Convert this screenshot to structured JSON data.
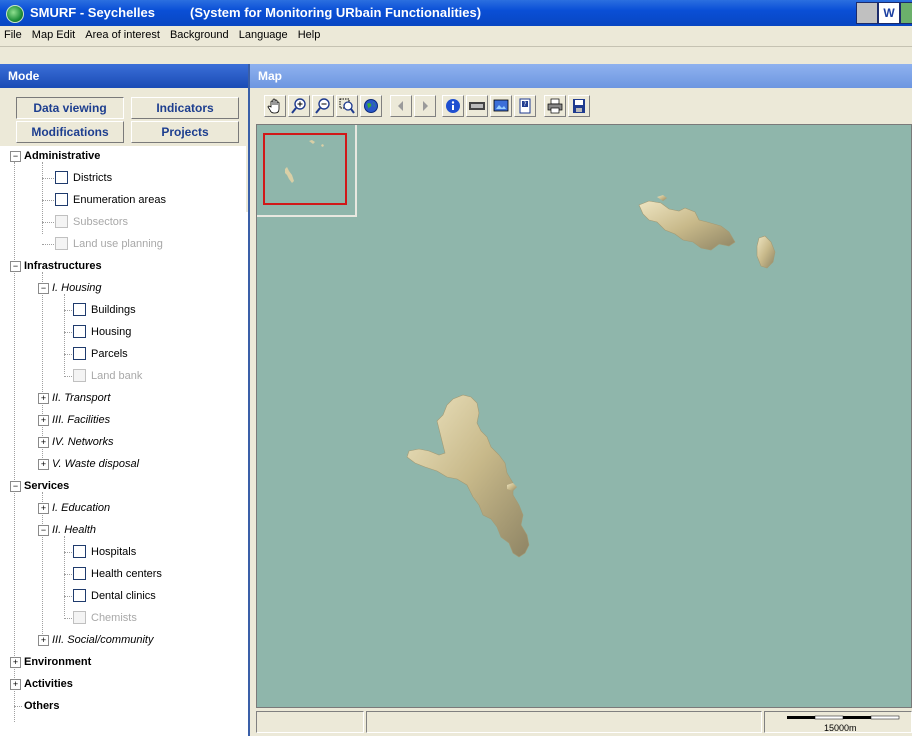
{
  "window": {
    "app_name": "SMURF - Seychelles",
    "subtitle": "(System for Monitoring URbain Functionalities)",
    "tray": [
      "",
      "W",
      ""
    ]
  },
  "menu": [
    "File",
    "Map Edit",
    "Area of interest",
    "Background",
    "Language",
    "Help"
  ],
  "mode_panel": {
    "title": "Mode",
    "buttons": [
      {
        "label": "Data viewing",
        "active": true
      },
      {
        "label": "Indicators",
        "active": false
      },
      {
        "label": "Modifications",
        "active": false
      },
      {
        "label": "Projects",
        "active": false
      }
    ]
  },
  "tree": [
    {
      "label": "Administrative",
      "type": "group",
      "expanded": true
    },
    {
      "label": "Districts",
      "type": "layer",
      "enabled": true
    },
    {
      "label": "Enumeration areas",
      "type": "layer",
      "enabled": true
    },
    {
      "label": "Subsectors",
      "type": "layer",
      "enabled": false
    },
    {
      "label": "Land use planning",
      "type": "layer",
      "enabled": false
    },
    {
      "label": "Infrastructures",
      "type": "group",
      "expanded": true
    },
    {
      "label": "I. Housing",
      "type": "subgroup",
      "expanded": true
    },
    {
      "label": "Buildings",
      "type": "layer",
      "enabled": true
    },
    {
      "label": "Housing",
      "type": "layer",
      "enabled": true
    },
    {
      "label": "Parcels",
      "type": "layer",
      "enabled": true
    },
    {
      "label": "Land bank",
      "type": "layer",
      "enabled": false
    },
    {
      "label": "II. Transport",
      "type": "subgroup",
      "expanded": false
    },
    {
      "label": "III. Facilities",
      "type": "subgroup",
      "expanded": false
    },
    {
      "label": "IV. Networks",
      "type": "subgroup",
      "expanded": false
    },
    {
      "label": "V. Waste disposal",
      "type": "subgroup",
      "expanded": false
    },
    {
      "label": "Services",
      "type": "group",
      "expanded": true
    },
    {
      "label": "I. Education",
      "type": "subgroup",
      "expanded": false
    },
    {
      "label": "II. Health",
      "type": "subgroup",
      "expanded": true
    },
    {
      "label": "Hospitals",
      "type": "layer",
      "enabled": true
    },
    {
      "label": "Health centers",
      "type": "layer",
      "enabled": true
    },
    {
      "label": "Dental clinics",
      "type": "layer",
      "enabled": true
    },
    {
      "label": "Chemists",
      "type": "layer",
      "enabled": false
    },
    {
      "label": "III. Social/community",
      "type": "subgroup",
      "expanded": false
    },
    {
      "label": "Environment",
      "type": "group",
      "expanded": false
    },
    {
      "label": "Activities",
      "type": "group",
      "expanded": false
    },
    {
      "label": "Others",
      "type": "group",
      "expanded": null
    }
  ],
  "map_panel": {
    "title": "Map",
    "toolbar": [
      {
        "icon": "pan-hand-icon"
      },
      {
        "icon": "zoom-in-icon"
      },
      {
        "icon": "zoom-out-icon"
      },
      {
        "icon": "zoom-window-icon"
      },
      {
        "icon": "full-extent-globe-icon"
      },
      {
        "icon": "back-arrow-icon"
      },
      {
        "icon": "forward-arrow-icon"
      },
      {
        "icon": "info-icon"
      },
      {
        "icon": "legend-icon"
      },
      {
        "icon": "print-map-icon"
      },
      {
        "icon": "help-doc-icon"
      },
      {
        "icon": "printer-icon"
      },
      {
        "icon": "save-disk-icon"
      }
    ],
    "scale_label": "15000m"
  },
  "colors": {
    "sea": "#8fb6ab",
    "land": "#d9cfa6",
    "title_bar": "#0a4fd6",
    "overview_frame": "#d11818"
  }
}
